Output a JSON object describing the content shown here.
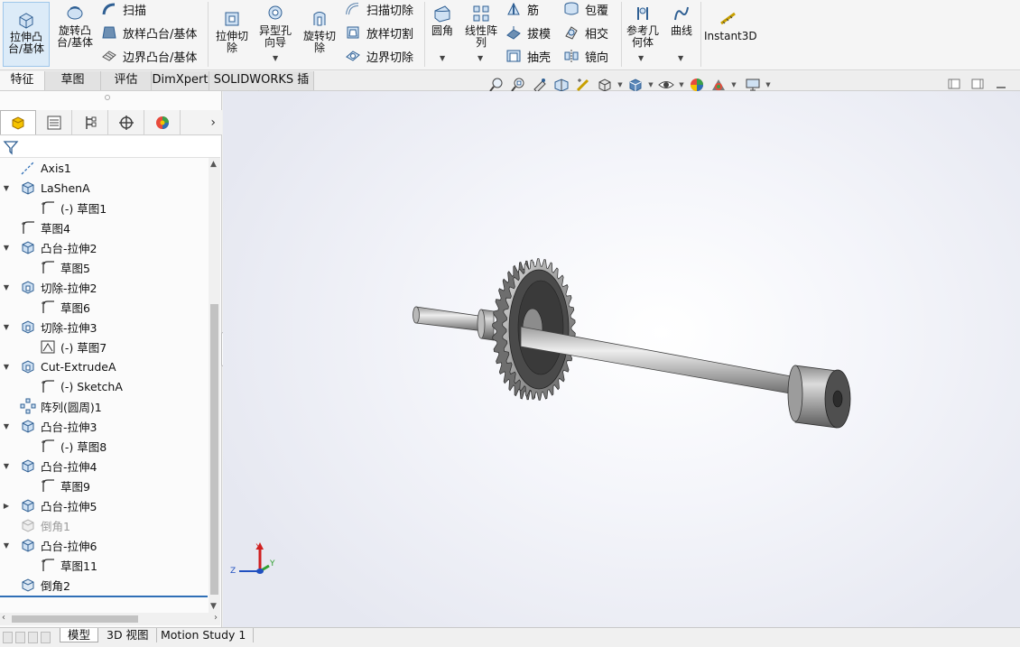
{
  "ribbon": {
    "extrude_boss": "拉伸凸台/基体",
    "revolve_boss": "旋转凸台/基体",
    "sweep": "扫描",
    "loft_boss": "放样凸台/基体",
    "boundary_boss": "边界凸台/基体",
    "extrude_cut": "拉伸切除",
    "hole_wizard": "异型孔向导",
    "revolve_cut": "旋转切除",
    "swept_cut": "扫描切除",
    "lofted_cut": "放样切割",
    "boundary_cut": "边界切除",
    "fillet": "圆角",
    "linear_pattern": "线性阵列",
    "rib": "筋",
    "draft": "拔模",
    "shell": "抽壳",
    "wrap": "包覆",
    "intersect": "相交",
    "mirror": "镜向",
    "ref_geometry": "参考几何体",
    "curves": "曲线",
    "instant3d": "Instant3D"
  },
  "tabs": [
    {
      "label": "特征",
      "active": true
    },
    {
      "label": "草图",
      "active": false
    },
    {
      "label": "评估",
      "active": false
    },
    {
      "label": "DimXpert",
      "active": false
    },
    {
      "label": "SOLIDWORKS 插件",
      "active": false
    }
  ],
  "tree": [
    {
      "label": "Axis1",
      "icon": "axis-icon",
      "level": 0,
      "expand": ""
    },
    {
      "label": "LaShenA",
      "icon": "extrude-feature-icon",
      "level": 0,
      "expand": "down"
    },
    {
      "label": "(-) 草图1",
      "icon": "sketch-icon",
      "level": 1,
      "expand": ""
    },
    {
      "label": "草图4",
      "icon": "sketch-icon",
      "level": 0,
      "expand": ""
    },
    {
      "label": "凸台-拉伸2",
      "icon": "extrude-feature-icon",
      "level": 0,
      "expand": "down"
    },
    {
      "label": "草图5",
      "icon": "sketch-icon",
      "level": 1,
      "expand": ""
    },
    {
      "label": "切除-拉伸2",
      "icon": "cut-feature-icon",
      "level": 0,
      "expand": "down"
    },
    {
      "label": "草图6",
      "icon": "sketch-icon",
      "level": 1,
      "expand": ""
    },
    {
      "label": "切除-拉伸3",
      "icon": "cut-feature-icon",
      "level": 0,
      "expand": "down"
    },
    {
      "label": "(-) 草图7",
      "icon": "sketch-3d-icon",
      "level": 1,
      "expand": ""
    },
    {
      "label": "Cut-ExtrudeA",
      "icon": "cut-feature-icon",
      "level": 0,
      "expand": "down"
    },
    {
      "label": "(-) SketchA",
      "icon": "sketch-icon",
      "level": 1,
      "expand": ""
    },
    {
      "label": "阵列(圆周)1",
      "icon": "circular-pattern-icon",
      "level": 0,
      "expand": ""
    },
    {
      "label": "凸台-拉伸3",
      "icon": "extrude-feature-icon",
      "level": 0,
      "expand": "down"
    },
    {
      "label": "(-) 草图8",
      "icon": "sketch-icon",
      "level": 1,
      "expand": ""
    },
    {
      "label": "凸台-拉伸4",
      "icon": "extrude-feature-icon",
      "level": 0,
      "expand": "down"
    },
    {
      "label": "草图9",
      "icon": "sketch-icon",
      "level": 1,
      "expand": ""
    },
    {
      "label": "凸台-拉伸5",
      "icon": "extrude-feature-icon",
      "level": 0,
      "expand": "right"
    },
    {
      "label": "倒角1",
      "icon": "chamfer-icon",
      "level": 0,
      "expand": "",
      "dim": true
    },
    {
      "label": "凸台-拉伸6",
      "icon": "extrude-feature-icon",
      "level": 0,
      "expand": "down"
    },
    {
      "label": "草图11",
      "icon": "sketch-icon",
      "level": 1,
      "expand": ""
    },
    {
      "label": "倒角2",
      "icon": "chamfer-icon",
      "level": 0,
      "expand": ""
    }
  ],
  "bottom_tabs": [
    {
      "label": "模型",
      "active": true
    },
    {
      "label": "3D 视图",
      "active": false
    },
    {
      "label": "Motion Study 1",
      "active": false
    }
  ],
  "triad": {
    "x": "X",
    "y": "Y",
    "z": "Z"
  },
  "colors": {
    "accent": "#2f6fb6",
    "gear": "#7c7c7c",
    "shaft": "#a9a9a9"
  }
}
